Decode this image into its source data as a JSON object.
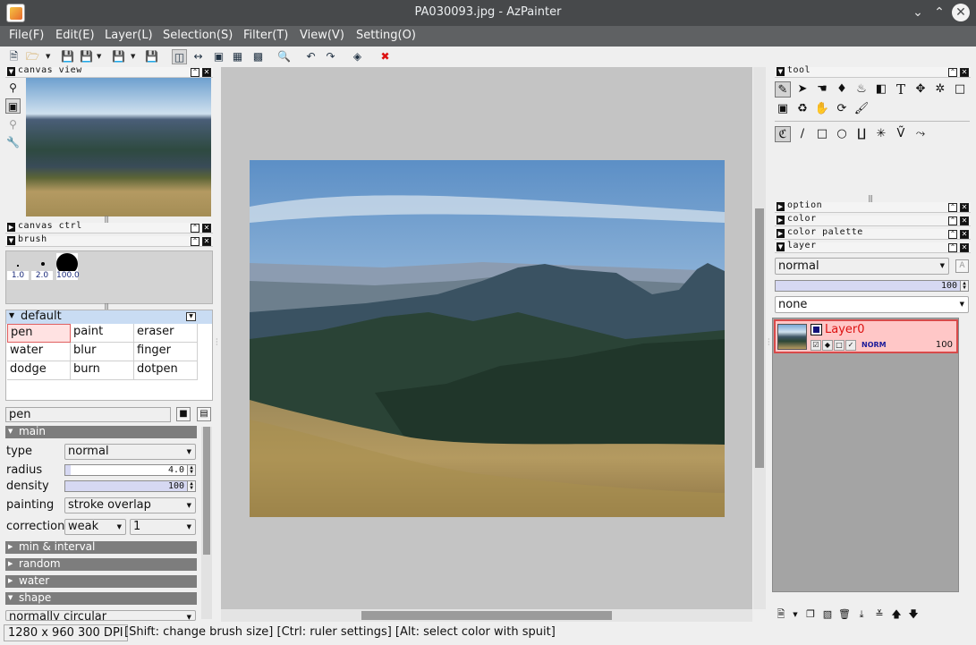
{
  "window": {
    "title": "PA030093.jpg - AzPainter"
  },
  "menu": [
    "File(F)",
    "Edit(E)",
    "Layer(L)",
    "Selection(S)",
    "Filter(T)",
    "View(V)",
    "Setting(O)"
  ],
  "panels": {
    "canvas_view": "canvas view",
    "canvas_ctrl": "canvas ctrl",
    "brush": "brush",
    "tool": "tool",
    "option": "option",
    "color": "color",
    "color_palette": "color palette",
    "layer": "layer"
  },
  "brush": {
    "sizes": [
      "1.0",
      "2.0",
      "100.0"
    ],
    "group": "default",
    "grid": [
      [
        "pen",
        "paint",
        "eraser"
      ],
      [
        "water",
        "blur",
        "finger"
      ],
      [
        "dodge",
        "burn",
        "dotpen"
      ]
    ],
    "selected": "pen",
    "name": "pen",
    "sections": {
      "main": "main",
      "min_interval": "min & interval",
      "random": "random",
      "water": "water",
      "shape": "shape"
    },
    "type_label": "type",
    "type_value": "normal",
    "radius_label": "radius",
    "radius_value": "4.0",
    "radius_fraction": 0.04,
    "density_label": "density",
    "density_value": "100",
    "density_fraction": 1.0,
    "painting_label": "painting",
    "painting_value": "stroke overlap",
    "correction_label": "correction",
    "correction_value": "weak",
    "correction_level": "1",
    "shape_value": "normally circular"
  },
  "layer": {
    "blend_mode": "normal",
    "opacity_value": "100",
    "opacity_fraction": 1.0,
    "texture": "none",
    "items": [
      {
        "name": "Layer0",
        "mode": "NORM",
        "opacity": "100"
      }
    ]
  },
  "status": {
    "info": "1280 x 960 300 DPI",
    "hint": "[Shift: change brush size] [Ctrl: ruler settings] [Alt: select color with spuit]"
  },
  "icons": {
    "close": "close-icon",
    "minimize": "minimize-icon",
    "maximize": "maximize-icon"
  }
}
